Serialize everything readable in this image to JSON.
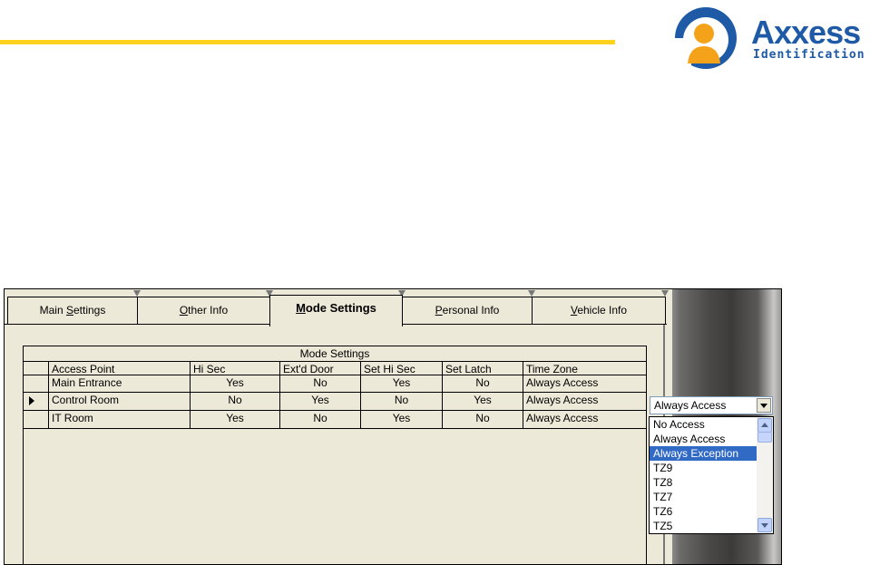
{
  "branding": {
    "logo_word": "Axxess",
    "logo_sub": "Identification",
    "colors": {
      "rule": "#ffd21e",
      "logo_blue": "#1e5aa6",
      "logo_orange": "#f5a21b"
    }
  },
  "tabs": [
    {
      "pre": "Main ",
      "key": "S",
      "post": "ettings",
      "active": false
    },
    {
      "pre": "",
      "key": "O",
      "post": "ther Info",
      "active": false
    },
    {
      "pre": "",
      "key": "M",
      "post": "ode Settings",
      "active": true
    },
    {
      "pre": "",
      "key": "P",
      "post": "ersonal Info",
      "active": false
    },
    {
      "pre": "",
      "key": "V",
      "post": "ehicle Info",
      "active": false
    }
  ],
  "grid": {
    "caption": "Mode Settings",
    "columns": [
      "Access Point",
      "Hi Sec",
      "Ext'd Door",
      "Set Hi Sec",
      "Set Latch",
      "Time Zone"
    ],
    "rows": [
      {
        "cells": [
          "Main Entrance",
          "Yes",
          "No",
          "Yes",
          "No",
          "Always Access"
        ],
        "current": false
      },
      {
        "cells": [
          "Control Room",
          "No",
          "Yes",
          "No",
          "Yes",
          "Always Access"
        ],
        "current": true
      },
      {
        "cells": [
          "IT Room",
          "Yes",
          "No",
          "Yes",
          "No",
          "Always Access"
        ],
        "current": false
      }
    ]
  },
  "time_zone_combo": {
    "value": "Always Access",
    "options": [
      "No Access",
      "Always Access",
      "Always Exception",
      "TZ9",
      "TZ8",
      "TZ7",
      "TZ6",
      "TZ5"
    ],
    "highlighted_index": 2
  }
}
